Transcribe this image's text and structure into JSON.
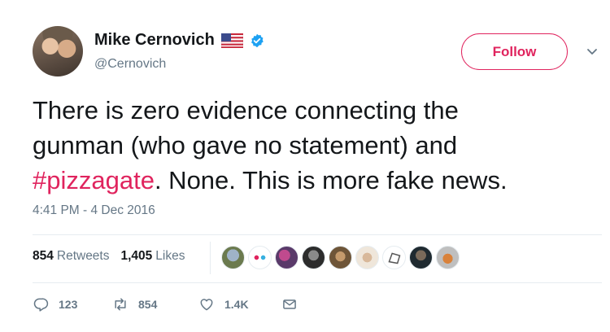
{
  "tweet": {
    "author": {
      "display_name": "Mike Cernovich",
      "handle": "@Cernovich",
      "flag_icon": "us-flag-icon",
      "verified_icon": "verified-badge-icon",
      "verified_color": "#1da1f2"
    },
    "follow_label": "Follow",
    "accent_color": "#e0245e",
    "text_line1": "There is zero evidence connecting the",
    "text_line2": "gunman (who gave no statement) and",
    "hashtag": "#pizzagate",
    "text_line3_rest": ". None. This is more fake news.",
    "timestamp": "4:41 PM - 4 Dec 2016",
    "stats": {
      "retweets_count": "854",
      "retweets_label": "Retweets",
      "likes_count": "1,405",
      "likes_label": "Likes"
    },
    "actions": {
      "replies": "123",
      "retweets": "854",
      "likes": "1.4K"
    }
  }
}
